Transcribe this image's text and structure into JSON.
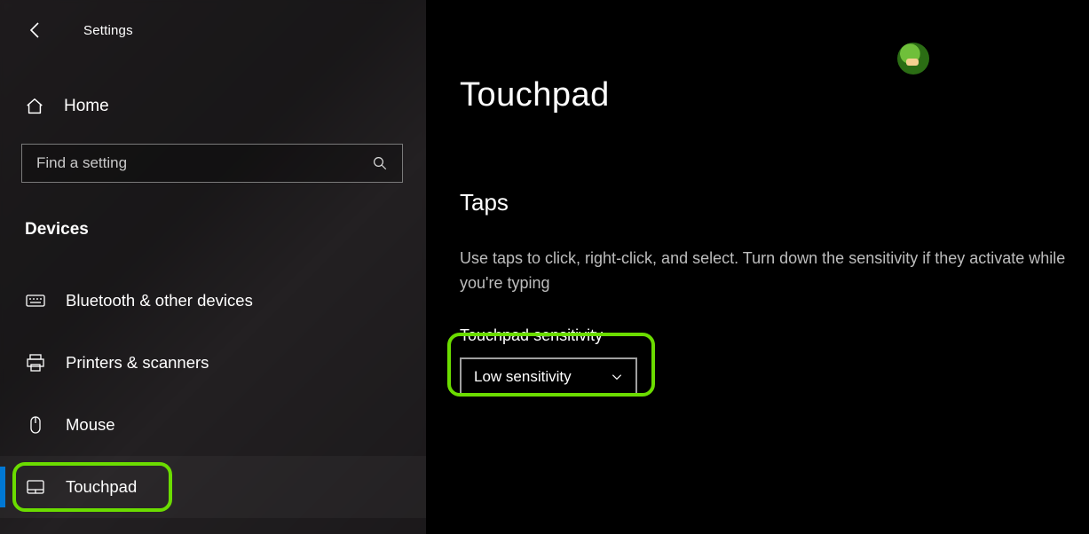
{
  "header": {
    "app_label": "Settings"
  },
  "home_label": "Home",
  "search": {
    "placeholder": "Find a setting"
  },
  "section_heading": "Devices",
  "nav": {
    "items": [
      {
        "label": "Bluetooth & other devices"
      },
      {
        "label": "Printers & scanners"
      },
      {
        "label": "Mouse"
      },
      {
        "label": "Touchpad"
      }
    ],
    "selected_index": 3
  },
  "main": {
    "title": "Touchpad",
    "section_title": "Taps",
    "description": "Use taps to click, right-click, and select. Turn down the sensitivity if they activate while you're typing",
    "field_label": "Touchpad sensitivity",
    "dropdown_value": "Low sensitivity"
  }
}
